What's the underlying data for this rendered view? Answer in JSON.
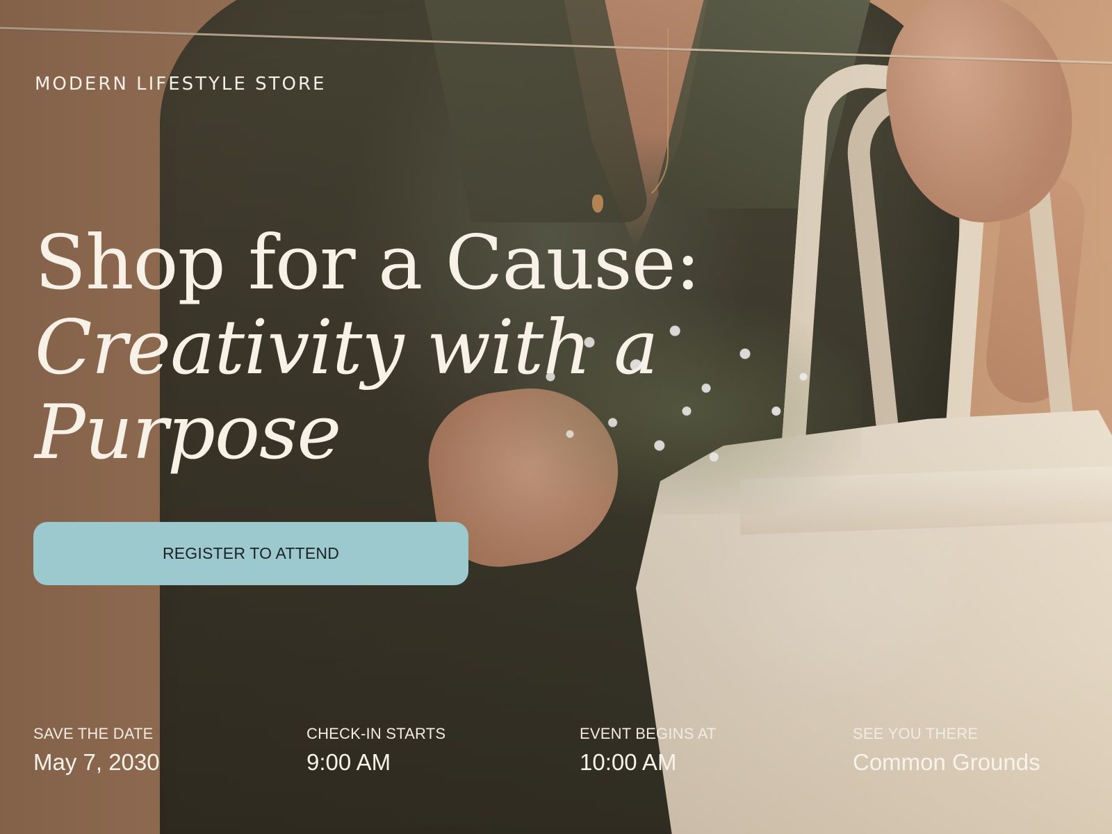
{
  "store": {
    "name": "MODERN LIFESTYLE STORE"
  },
  "hero": {
    "headline_plain": "Shop for a Cause: ",
    "headline_italic": "Creativity with a Purpose"
  },
  "cta": {
    "label": "REGISTER TO ATTEND"
  },
  "details": [
    {
      "label": "SAVE THE DATE",
      "value": "May 7, 2030"
    },
    {
      "label": "CHECK-IN STARTS",
      "value": "9:00 AM"
    },
    {
      "label": "EVENT BEGINS AT",
      "value": "10:00 AM"
    },
    {
      "label": "SEE YOU THERE",
      "value": "Common Grounds"
    }
  ],
  "colors": {
    "background": "#b48a6b",
    "text": "#f7f1e7",
    "button": "#9bc9ce",
    "button_text": "#1c2124"
  }
}
